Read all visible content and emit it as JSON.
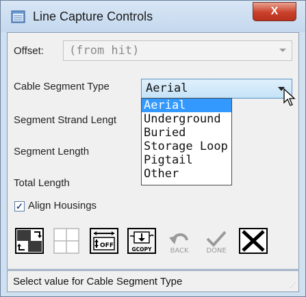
{
  "window": {
    "title": "Line Capture Controls",
    "close_label": "X"
  },
  "offset": {
    "label": "Offset:",
    "value": "(from hit)"
  },
  "cable_segment_type": {
    "label": "Cable Segment Type",
    "value": "Aerial",
    "options": [
      {
        "label": "Aerial",
        "selected": true
      },
      {
        "label": "Underground"
      },
      {
        "label": "Buried"
      },
      {
        "label": "Storage Loop"
      },
      {
        "label": "Pigtail"
      },
      {
        "label": "Other"
      }
    ]
  },
  "fields": {
    "segment_strand_length_label": "Segment Strand Lengt",
    "segment_length_label": "Segment Length",
    "total_length_label": "Total Length"
  },
  "align_housings": {
    "label": "Align Housings",
    "checked": true
  },
  "toolbar": {
    "buttons": [
      {
        "name": "split-view-icon",
        "label": ""
      },
      {
        "name": "grid-cross-icon",
        "label": ""
      },
      {
        "name": "offset-toggle-icon",
        "label": "OFF"
      },
      {
        "name": "gcopy-icon",
        "label": "GCOPY"
      },
      {
        "name": "back-icon",
        "label": "BACK"
      },
      {
        "name": "done-icon",
        "label": "DONE"
      },
      {
        "name": "cancel-x-icon",
        "label": ""
      }
    ]
  },
  "status": {
    "text": "Select value for Cable Segment Type"
  },
  "colors": {
    "selection": "#3399ff",
    "close_button": "#c9402a",
    "frame": "#cfe0f1"
  }
}
